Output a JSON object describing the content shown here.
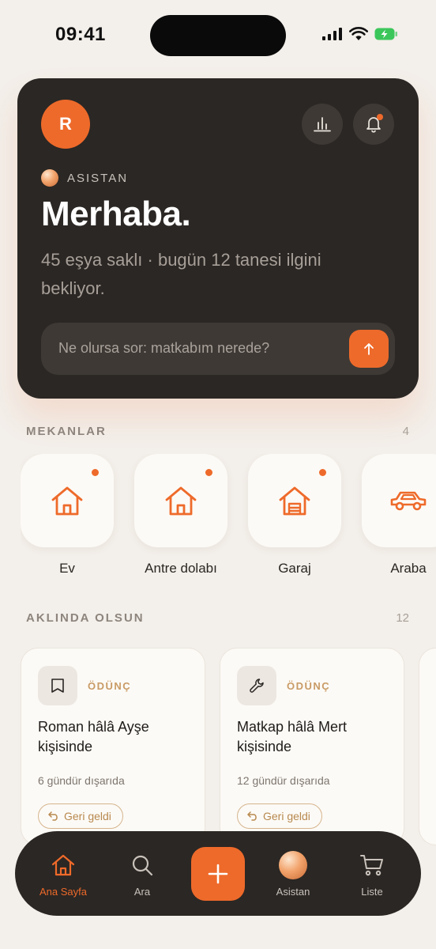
{
  "status": {
    "time": "09:41"
  },
  "hero": {
    "avatar_initial": "R",
    "assistant_label": "ASISTAN",
    "title": "Merhaba.",
    "subtitle": "45 eşya saklı · bugün 12 tanesi ilgini bekliyor.",
    "ask_placeholder": "Ne olursa sor: matkabım nerede?"
  },
  "places": {
    "title": "MEKANLAR",
    "count": "4",
    "items": [
      {
        "label": "Ev",
        "icon": "house-icon",
        "has_dot": true
      },
      {
        "label": "Antre dolabı",
        "icon": "house-icon",
        "has_dot": true
      },
      {
        "label": "Garaj",
        "icon": "garage-icon",
        "has_dot": true
      },
      {
        "label": "Araba",
        "icon": "car-icon",
        "has_dot": false
      }
    ]
  },
  "reminders": {
    "title": "AKLINDA OLSUN",
    "count": "12",
    "cards": [
      {
        "icon": "book-icon",
        "tag": "ÖDÜNÇ",
        "title": "Roman hâlâ Ayşe kişisinde",
        "meta": "6 gündür dışarıda",
        "action": "Geri geldi"
      },
      {
        "icon": "wrench-icon",
        "tag": "ÖDÜNÇ",
        "title": "Matkap hâlâ Mert kişisinde",
        "meta": "12 gündür dışarıda",
        "action": "Geri geldi"
      }
    ]
  },
  "tabbar": {
    "home": "Ana Sayfa",
    "search": "Ara",
    "assistant": "Asistan",
    "list": "Liste"
  },
  "colors": {
    "accent": "#ee6a2a",
    "dark": "#2b2724",
    "background": "#f3efea"
  }
}
